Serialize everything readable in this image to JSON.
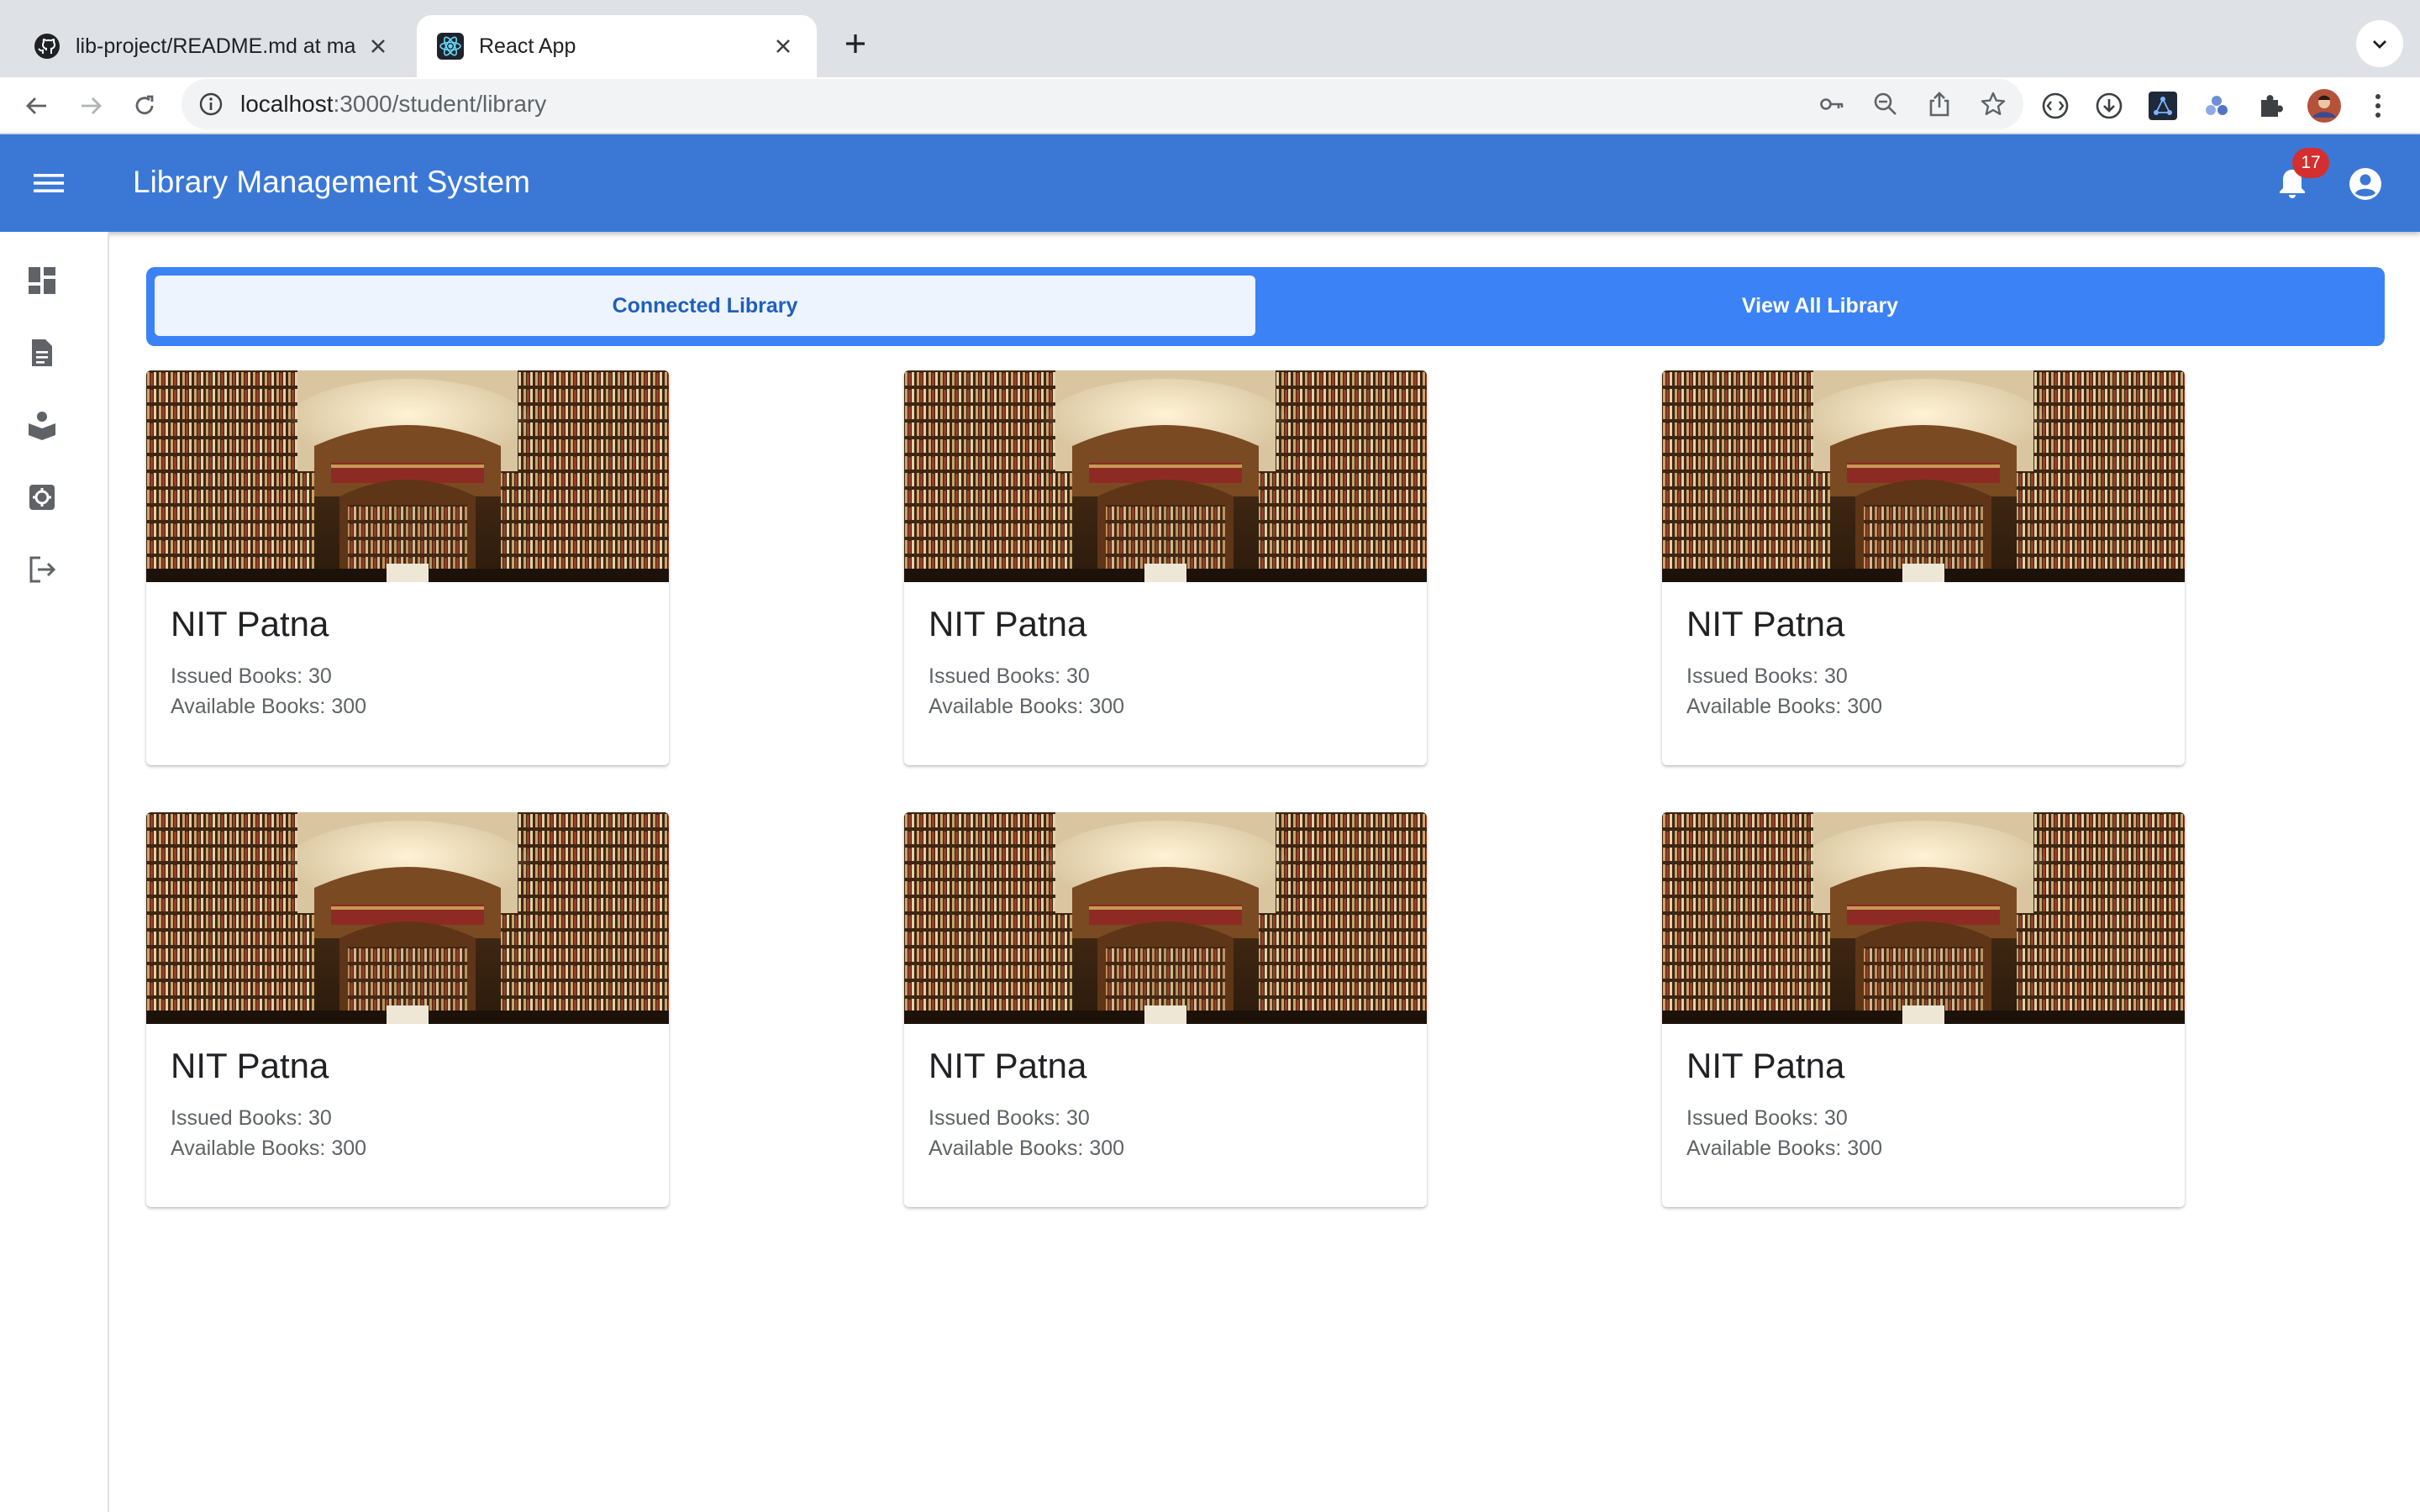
{
  "browser": {
    "tabs": [
      {
        "title": "lib-project/README.md at main",
        "active": false,
        "favicon": "github-icon"
      },
      {
        "title": "React App",
        "active": true,
        "favicon": "react-icon"
      }
    ],
    "url_host": "localhost",
    "url_path": ":3000/student/library"
  },
  "app": {
    "title": "Library Management System",
    "notifications": "17",
    "colors": {
      "appbar": "#3b78d6",
      "tabs": "#3b82f6",
      "badge": "#d32f2f"
    }
  },
  "sidebar": {
    "items": [
      {
        "icon": "dashboard-icon"
      },
      {
        "icon": "description-icon"
      },
      {
        "icon": "reader-icon"
      },
      {
        "icon": "settings-icon"
      },
      {
        "icon": "logout-icon"
      }
    ]
  },
  "tabs": {
    "connected": "Connected Library",
    "view_all": "View All Library"
  },
  "libraries": [
    {
      "name": "NIT Patna",
      "issued": "Issued Books: 30",
      "available": "Available Books: 300"
    },
    {
      "name": "NIT Patna",
      "issued": "Issued Books: 30",
      "available": "Available Books: 300"
    },
    {
      "name": "NIT Patna",
      "issued": "Issued Books: 30",
      "available": "Available Books: 300"
    },
    {
      "name": "NIT Patna",
      "issued": "Issued Books: 30",
      "available": "Available Books: 300"
    },
    {
      "name": "NIT Patna",
      "issued": "Issued Books: 30",
      "available": "Available Books: 300"
    },
    {
      "name": "NIT Patna",
      "issued": "Issued Books: 30",
      "available": "Available Books: 300"
    }
  ]
}
